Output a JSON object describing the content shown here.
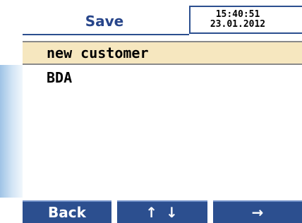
{
  "header": {
    "title": "Save",
    "time": "15:40:51",
    "date": "23.01.2012"
  },
  "list": {
    "items": [
      {
        "label": "new customer",
        "selected": true
      },
      {
        "label": "BDA",
        "selected": false
      }
    ]
  },
  "softkeys": {
    "back": {
      "label": "Back"
    },
    "updown": {
      "up_icon": "arrow-up-icon",
      "down_icon": "arrow-down-icon",
      "up_glyph": "↑",
      "down_glyph": "↓"
    },
    "next": {
      "icon": "arrow-right-icon",
      "glyph": "→"
    }
  },
  "colors": {
    "accent": "#2c4f8f",
    "title_text": "#27458a",
    "selection_bg": "#f6e7bf",
    "strip_gradient_start": "#9fc3e6"
  }
}
